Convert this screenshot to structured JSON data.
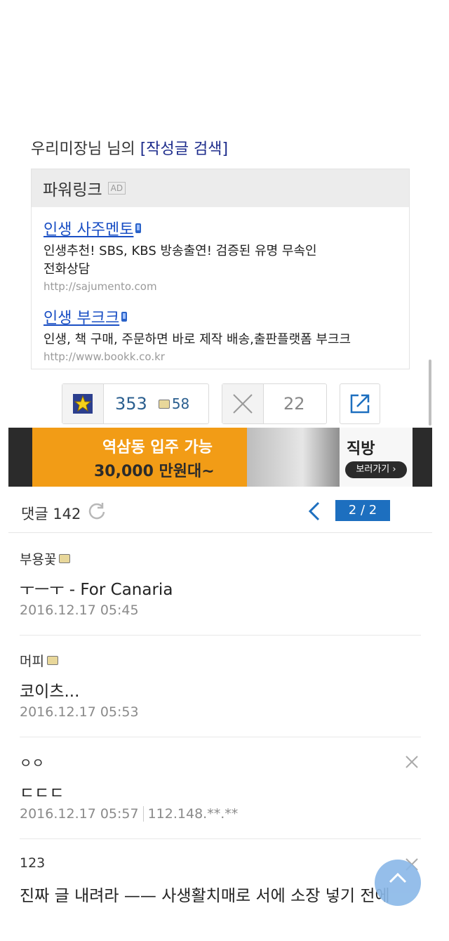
{
  "author_line": {
    "author": "우리미장님 님의",
    "search_link": "[작성글 검색]"
  },
  "powerlink": {
    "title": "파워링크",
    "ad_badge": "AD",
    "ads": [
      {
        "title": "인생 사주멘토",
        "desc1": "인생추천! SBS, KBS 방송출연! 검증된 유명 무속인",
        "desc2": "전화상담",
        "url": "http://sajumento.com"
      },
      {
        "title": "인생 부크크",
        "desc1": "인생, 책 구매, 주문하면 바로 제작 배송,출판플랫폼 부크크",
        "url": "http://www.bookk.co.kr"
      }
    ]
  },
  "votes": {
    "up_count": "353",
    "up_sub": "58",
    "down_count": "22"
  },
  "banner": {
    "line1": "역삼동 입주 가능",
    "line2": "30,000 만원대~",
    "brand": "직방",
    "cta": "보러가기 ›"
  },
  "comment_bar": {
    "label": "댓글 142",
    "page": "2 / 2"
  },
  "comments": [
    {
      "author": "부용꽃",
      "body": "ㅜㅡㅜ - For Canaria",
      "date": "2016.12.17 05:45"
    },
    {
      "author": "머피",
      "body": "코이츠...",
      "date": "2016.12.17 05:53"
    },
    {
      "author": "ㅇㅇ",
      "body": "ㄷㄷㄷ",
      "date": "2016.12.17 05:57",
      "ip": "112.148.**.**"
    },
    {
      "author": "123",
      "body": "진짜 글 내려라 —— 사생활치매로 서에 소장 넣기 전에"
    }
  ],
  "colors": {
    "link": "#1a4fc4",
    "accent": "#1d6fbf",
    "banner": "#f29c16"
  },
  "icons": [
    "star-icon",
    "close-icon",
    "share-icon",
    "refresh-icon",
    "chevron-left-icon",
    "chevron-up-icon"
  ]
}
